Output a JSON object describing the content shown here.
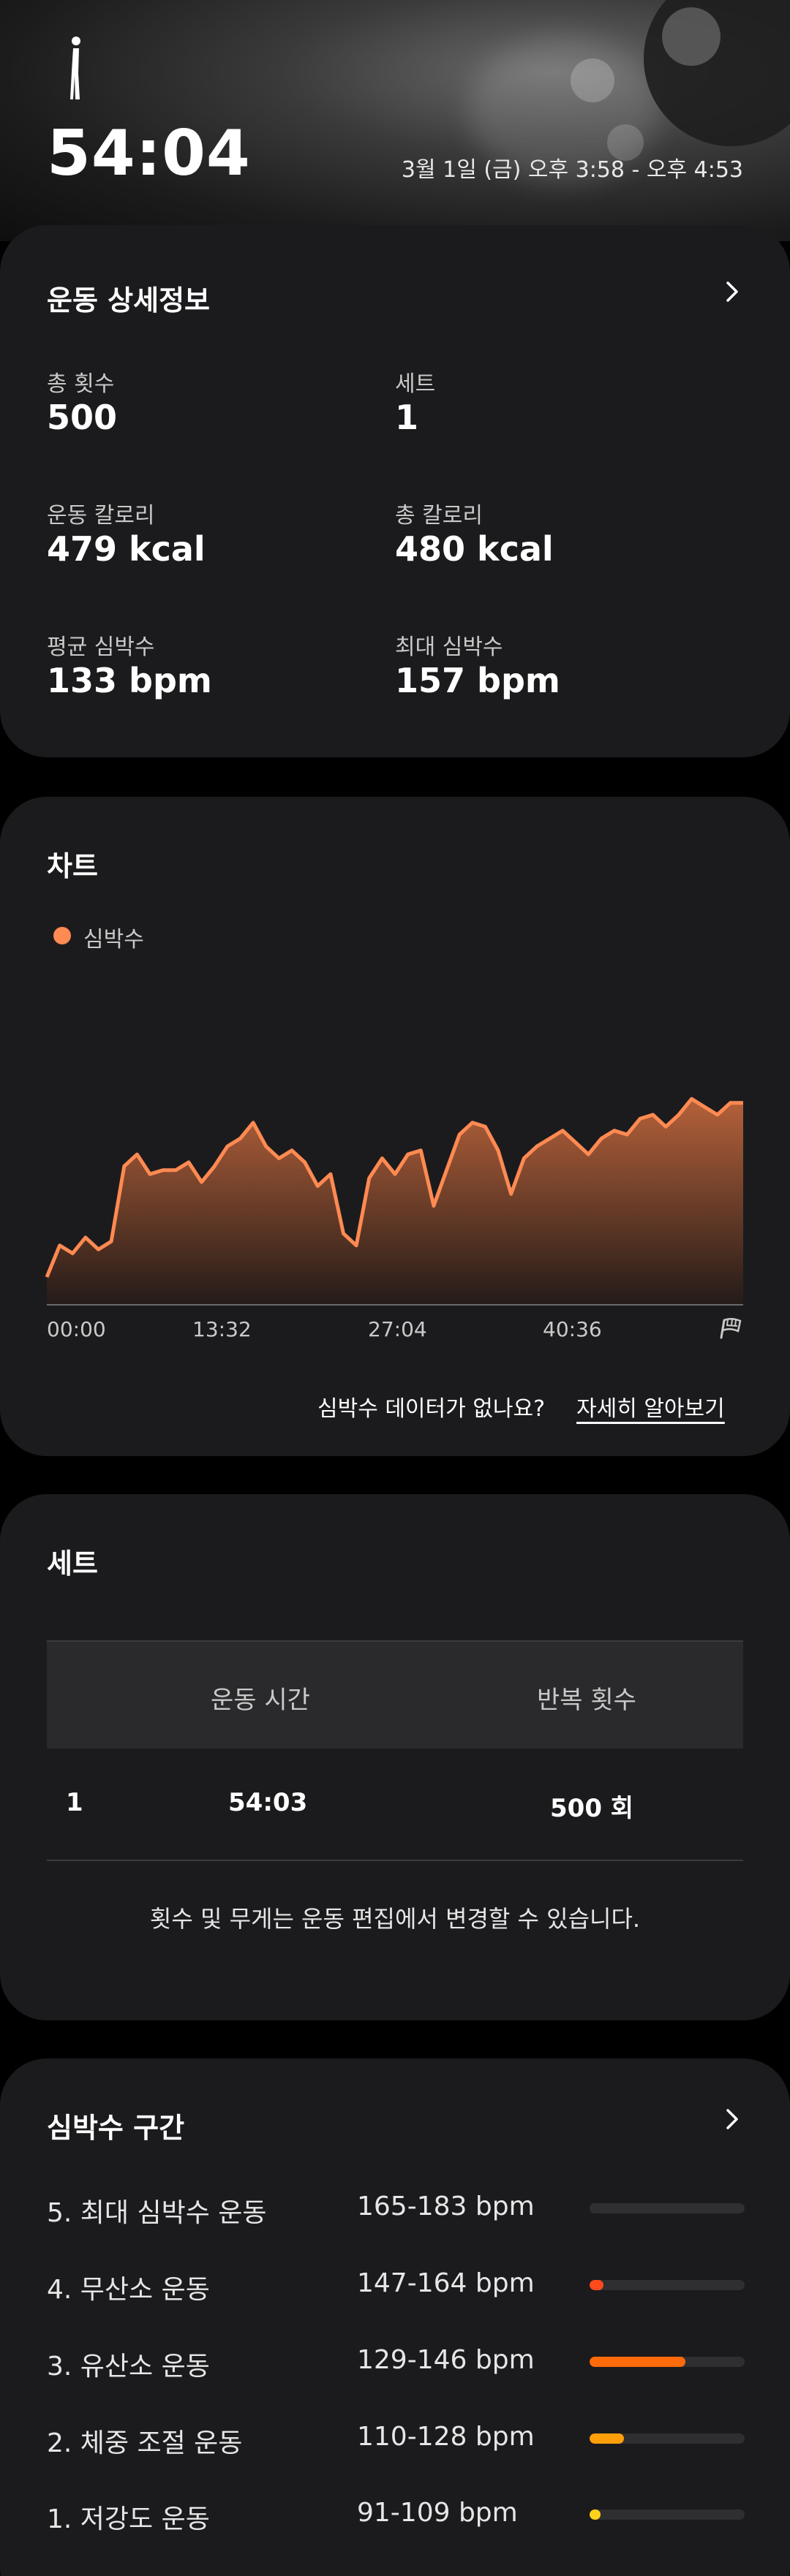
{
  "header": {
    "duration": "54:04",
    "date_range": "3월 1일 (금) 오후 3:58 - 오후 4:53"
  },
  "details": {
    "title": "운동 상세정보",
    "stats": [
      {
        "label": "총 횟수",
        "value": "500"
      },
      {
        "label": "세트",
        "value": "1"
      },
      {
        "label": "운동 칼로리",
        "value": "479 kcal"
      },
      {
        "label": "총 칼로리",
        "value": "480 kcal"
      },
      {
        "label": "평균 심박수",
        "value": "133 bpm"
      },
      {
        "label": "최대 심박수",
        "value": "157 bpm"
      }
    ]
  },
  "chart": {
    "title": "차트",
    "legend": "심박수",
    "no_data_text": "심박수 데이터가 없나요?",
    "learn_more": "자세히 알아보기"
  },
  "chart_data": {
    "type": "area",
    "x_ticks": [
      "00:00",
      "13:32",
      "27:04",
      "40:36"
    ],
    "series": [
      {
        "name": "심박수",
        "x_minutes": [
          0,
          1,
          2,
          3,
          4,
          5,
          6,
          7,
          8,
          9,
          10,
          11,
          12,
          13,
          14,
          15,
          16,
          17,
          18,
          19,
          20,
          21,
          22,
          23,
          24,
          25,
          26,
          27,
          28,
          29,
          30,
          31,
          32,
          33,
          34,
          35,
          36,
          37,
          38,
          39,
          40,
          41,
          42,
          43,
          44,
          45,
          46,
          47,
          48,
          49,
          50,
          51,
          52,
          53,
          54
        ],
        "values": [
          102,
          110,
          108,
          112,
          109,
          111,
          130,
          133,
          128,
          129,
          129,
          131,
          126,
          130,
          135,
          137,
          141,
          135,
          132,
          134,
          131,
          125,
          128,
          113,
          110,
          127,
          132,
          128,
          133,
          134,
          120,
          129,
          138,
          141,
          140,
          134,
          123,
          132,
          135,
          137,
          139,
          136,
          133,
          137,
          139,
          138,
          142,
          143,
          140,
          143,
          147,
          145,
          143,
          146,
          146
        ]
      }
    ],
    "ylim": [
      95,
      155
    ],
    "colors": {
      "line": "#ff8a52",
      "fill_top": "#b5613a",
      "fill_bottom": "#241b18"
    }
  },
  "sets": {
    "title": "세트",
    "col_time": "운동 시간",
    "col_reps": "반복 횟수",
    "rows": [
      {
        "index": "1",
        "time": "54:03",
        "reps": "500 회"
      }
    ],
    "note": "횟수 및 무게는 운동 편집에서 변경할 수 있습니다."
  },
  "zones": {
    "title": "심박수 구간",
    "items": [
      {
        "name": "5. 최대 심박수 운동",
        "range": "165-183 bpm",
        "fraction": 0.0,
        "color": "#ff3b1f"
      },
      {
        "name": "4. 무산소 운동",
        "range": "147-164 bpm",
        "fraction": 0.09,
        "color": "#ff4a1c"
      },
      {
        "name": "3. 유산소 운동",
        "range": "129-146 bpm",
        "fraction": 0.62,
        "color": "#ff6a0a"
      },
      {
        "name": "2. 체중 조절 운동",
        "range": "110-128 bpm",
        "fraction": 0.22,
        "color": "#ff9f0a"
      },
      {
        "name": "1. 저강도 운동",
        "range": "91-109 bpm",
        "fraction": 0.07,
        "color": "#ffd21a"
      }
    ]
  }
}
